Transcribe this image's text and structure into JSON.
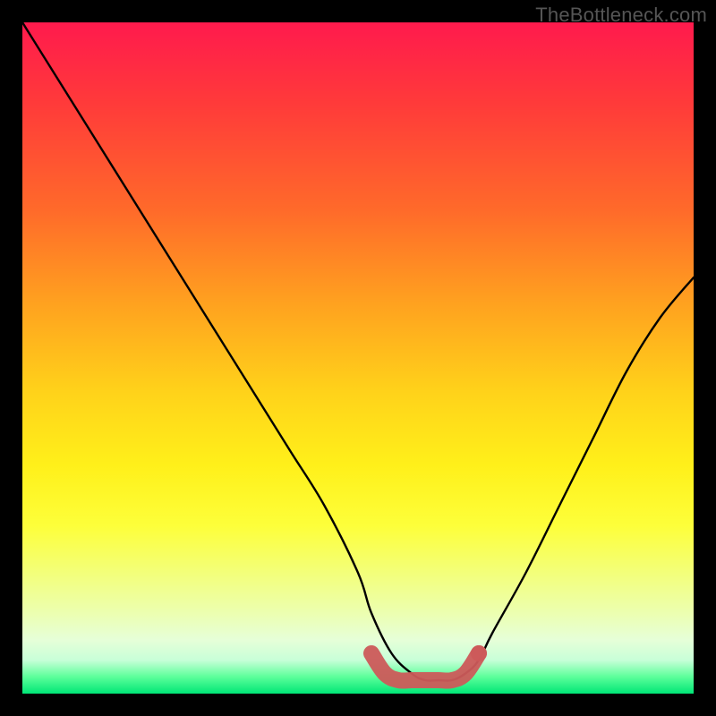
{
  "attribution": "TheBottleneck.com",
  "chart_data": {
    "type": "line",
    "title": "",
    "xlabel": "",
    "ylabel": "",
    "xlim": [
      0,
      100
    ],
    "ylim": [
      0,
      100
    ],
    "grid": false,
    "series": [
      {
        "name": "bottleneck-curve",
        "color": "#000000",
        "x": [
          0,
          5,
          10,
          15,
          20,
          25,
          30,
          35,
          40,
          45,
          50,
          52,
          55,
          58,
          60,
          62,
          64,
          66,
          68,
          70,
          75,
          80,
          85,
          90,
          95,
          100
        ],
        "y": [
          100,
          92,
          84,
          76,
          68,
          60,
          52,
          44,
          36,
          28,
          18,
          12,
          6,
          3,
          2,
          2,
          2,
          3,
          5,
          9,
          18,
          28,
          38,
          48,
          56,
          62
        ]
      },
      {
        "name": "optimal-range-marker",
        "color": "#cc5a5a",
        "x": [
          52,
          54,
          56,
          58,
          60,
          62,
          64,
          66,
          68
        ],
        "y": [
          6,
          3,
          2,
          2,
          2,
          2,
          2,
          3,
          6
        ]
      }
    ],
    "annotations": []
  }
}
